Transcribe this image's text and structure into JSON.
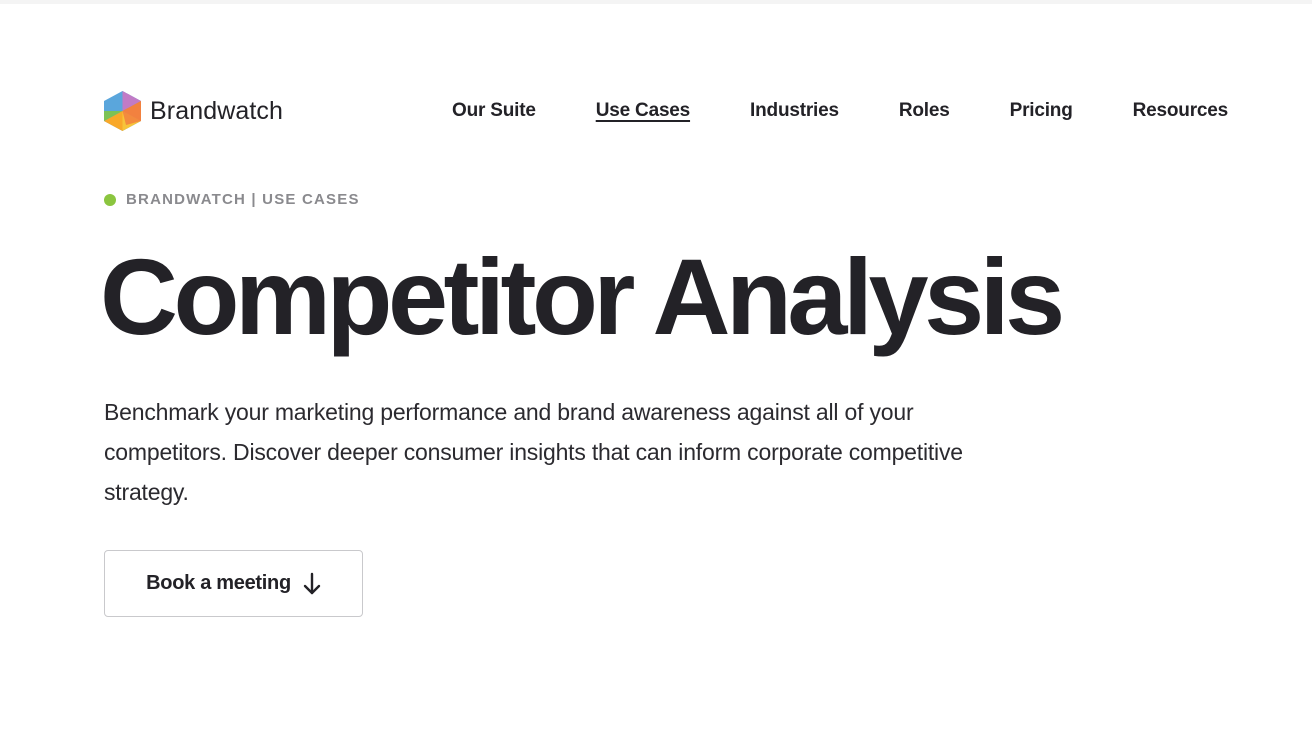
{
  "header": {
    "logo_text": "Brandwatch",
    "logo_icon": "brandwatch-hexagon-logo",
    "nav": [
      {
        "label": "Our Suite",
        "active": false
      },
      {
        "label": "Use Cases",
        "active": true
      },
      {
        "label": "Industries",
        "active": false
      },
      {
        "label": "Roles",
        "active": false
      },
      {
        "label": "Pricing",
        "active": false
      },
      {
        "label": "Resources",
        "active": false
      }
    ]
  },
  "eyebrow": {
    "text": "BRANDWATCH | USE CASES",
    "dot_color": "#8bc53f"
  },
  "hero": {
    "title": "Competitor Analysis",
    "description": "Benchmark your marketing performance and brand awareness against all of your competitors. Discover deeper consumer insights that can inform corporate competitive strategy.",
    "cta_label": "Book a meeting",
    "cta_icon": "arrow-down-icon"
  },
  "colors": {
    "text": "#232227",
    "muted": "#8a8a8e",
    "accent_green": "#8bc53f",
    "border": "#c9c9cc"
  }
}
